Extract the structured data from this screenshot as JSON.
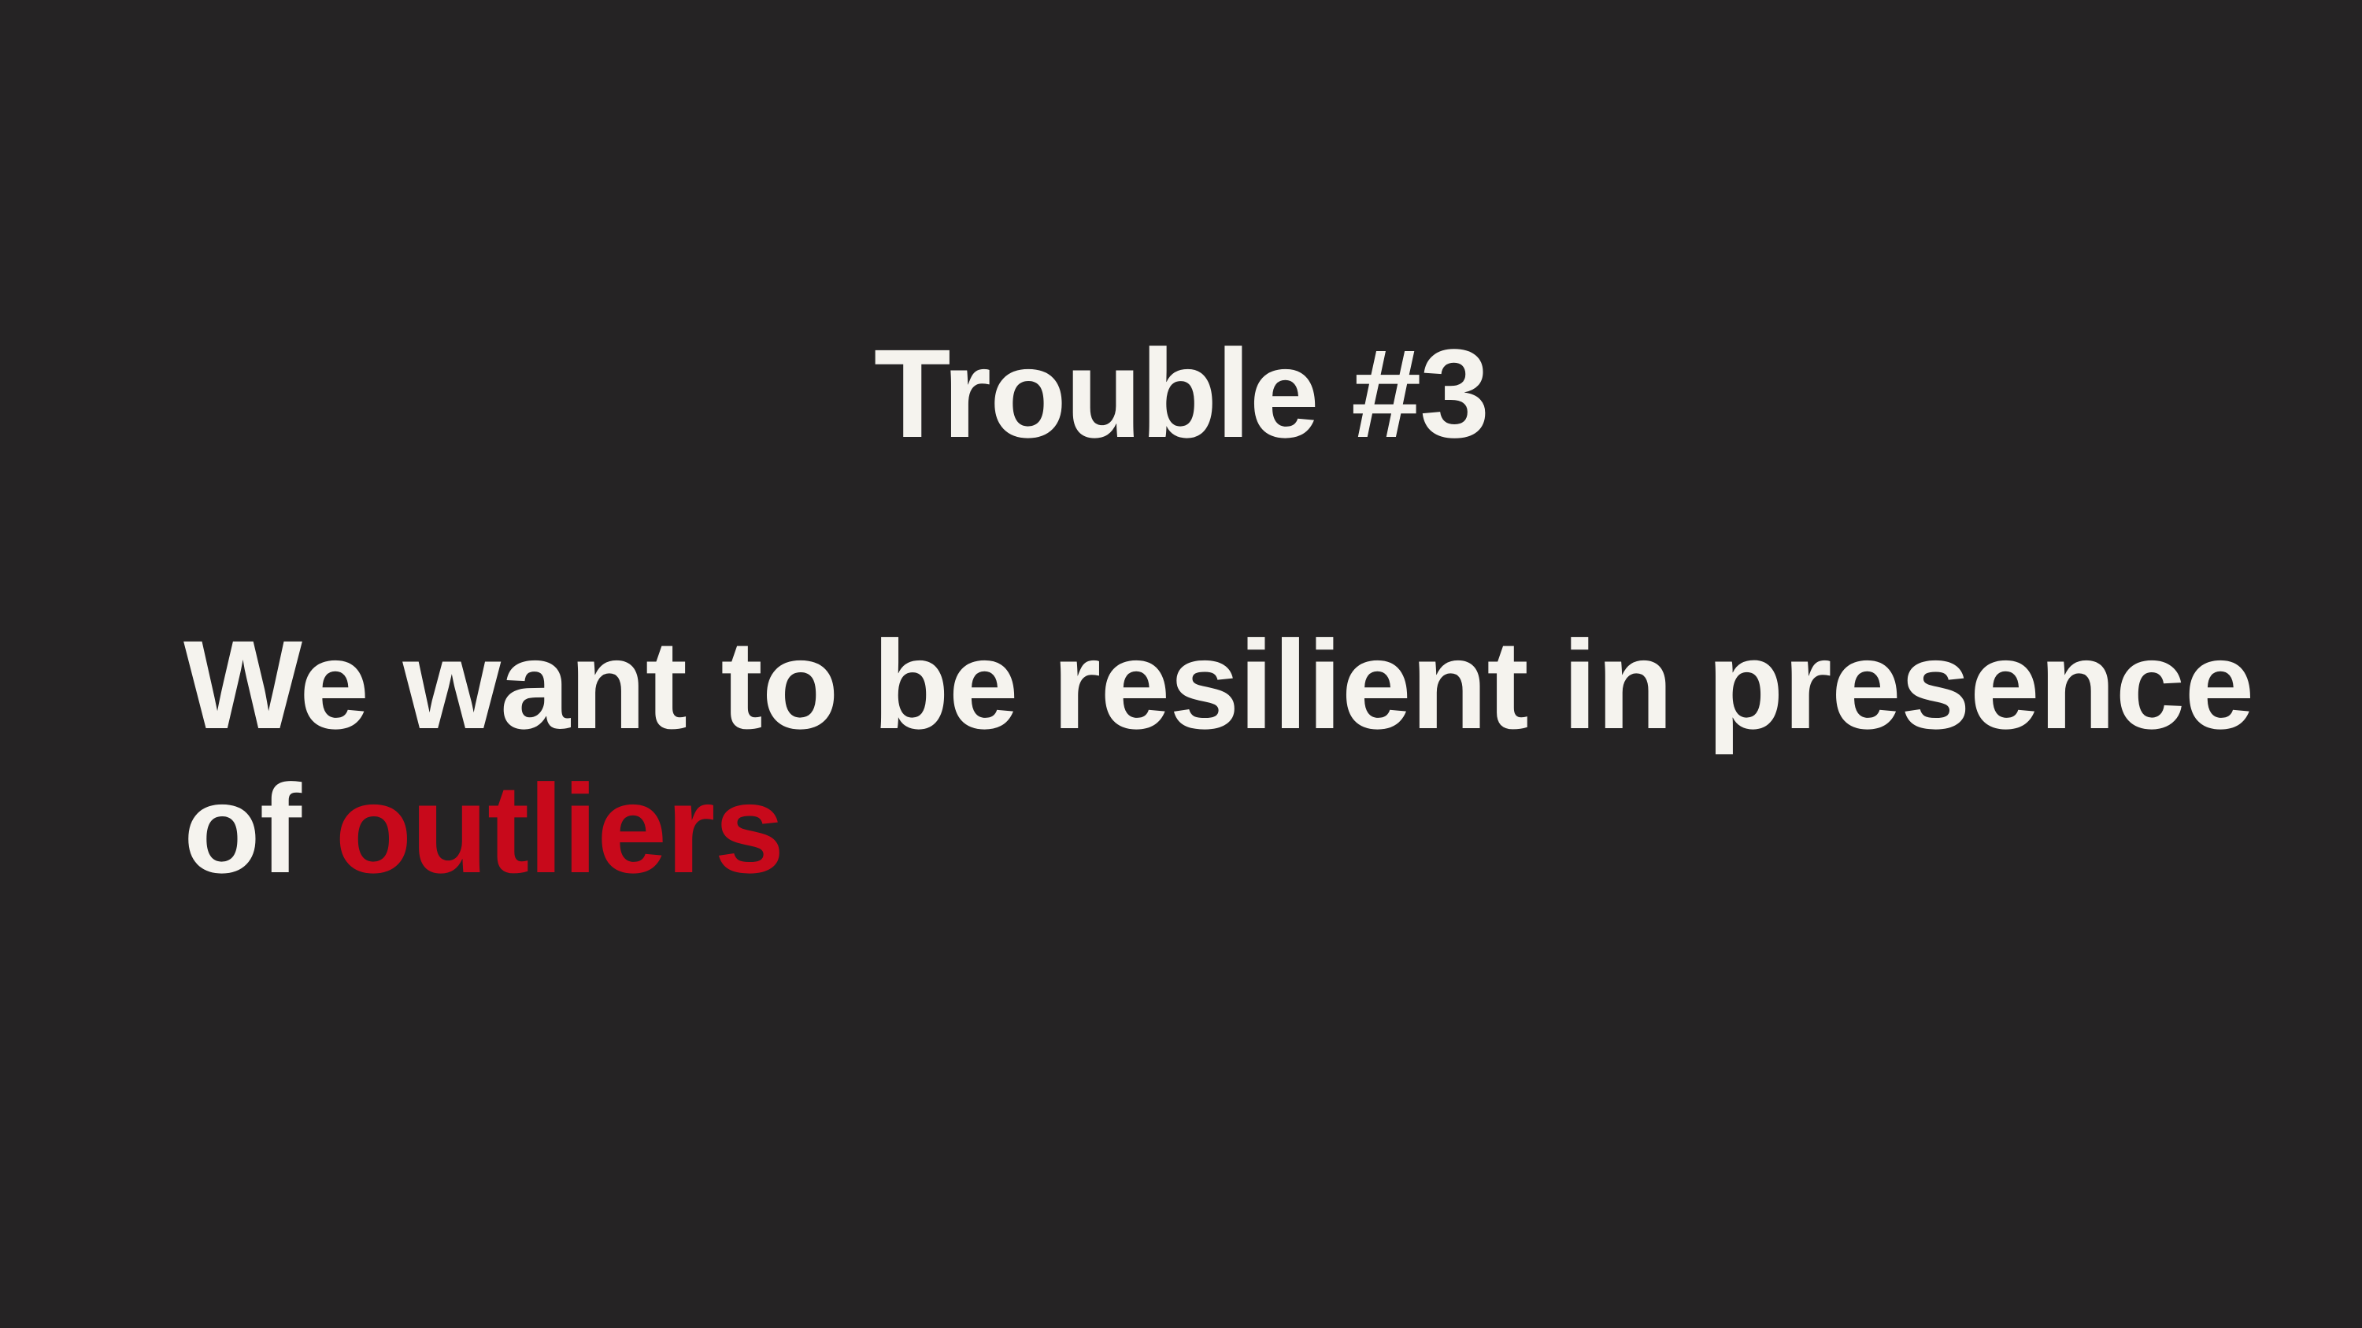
{
  "slide": {
    "title": "Trouble #3",
    "body": {
      "line1": "We want to be resilient in presence",
      "line2_prefix": "of ",
      "line2_highlight": "outliers"
    },
    "colors": {
      "background": "#252324",
      "text": "#f5f3ee",
      "highlight": "#c8091b"
    }
  }
}
